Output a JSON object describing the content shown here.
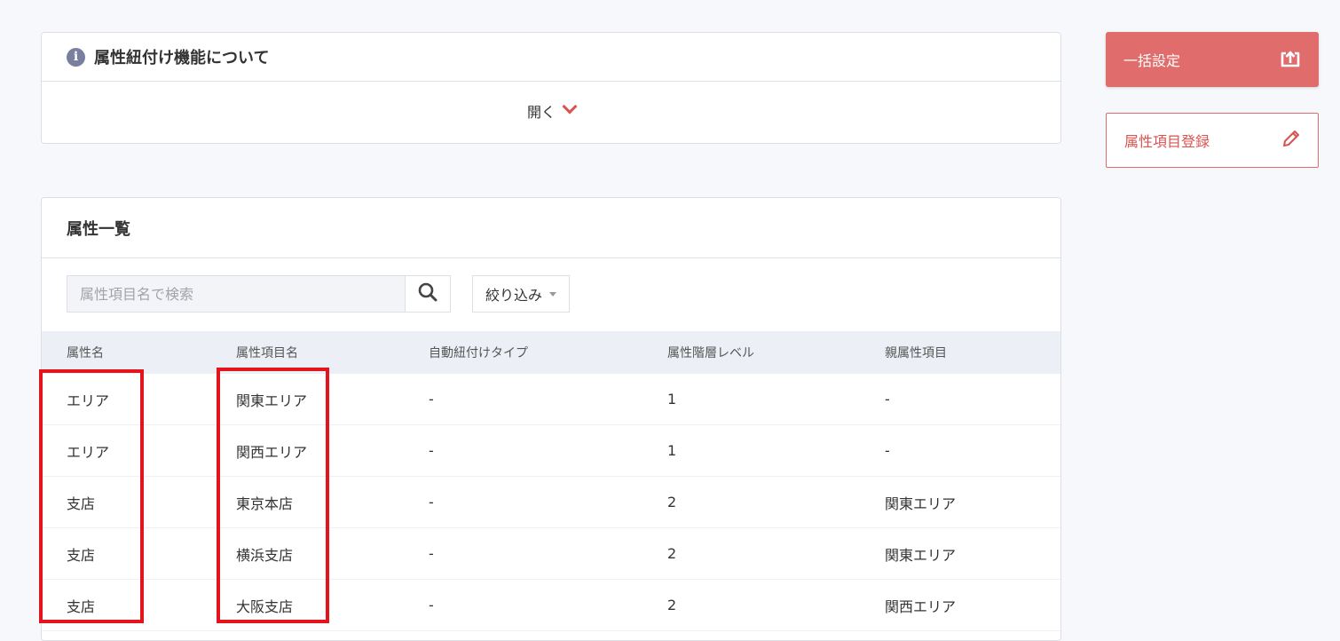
{
  "info_card": {
    "title": "属性紐付け機能について",
    "toggle_label": "開く",
    "info_icon_glyph": "i"
  },
  "actions": {
    "bulk_label": "一括設定",
    "register_label": "属性項目登録"
  },
  "list": {
    "title": "属性一覧",
    "search_placeholder": "属性項目名で検索",
    "filter_label": "絞り込み",
    "columns": [
      "属性名",
      "属性項目名",
      "自動紐付けタイプ",
      "属性階層レベル",
      "親属性項目"
    ],
    "rows": [
      [
        "エリア",
        "関東エリア",
        "-",
        "1",
        "-"
      ],
      [
        "エリア",
        "関西エリア",
        "-",
        "1",
        "-"
      ],
      [
        "支店",
        "東京本店",
        "-",
        "2",
        "関東エリア"
      ],
      [
        "支店",
        "横浜支店",
        "-",
        "2",
        "関東エリア"
      ],
      [
        "支店",
        "大阪支店",
        "-",
        "2",
        "関西エリア"
      ]
    ]
  },
  "colors": {
    "accent": "#e06c6c",
    "highlight": "#e3141c",
    "header_bg": "#ecf0f6"
  }
}
